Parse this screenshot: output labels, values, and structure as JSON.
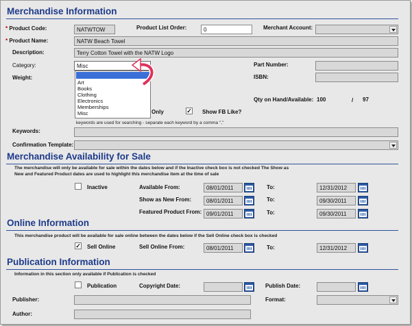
{
  "sections": {
    "merch": "Merchandise Information",
    "avail": "Merchandise Availability for Sale",
    "online": "Online Information",
    "pub": "Publication Information"
  },
  "merch": {
    "product_code_label": "Product Code:",
    "product_code_value": "NATWTOW",
    "product_list_order_label": "Product List Order:",
    "product_list_order_value": "0",
    "merchant_account_label": "Merchant Account:",
    "product_name_label": "Product Name:",
    "product_name_value": "NATW Beach Towel",
    "description_label": "Description:",
    "description_value": "Terry Cotton Towel with the NATW Logo",
    "category_label": "Category:",
    "category_value": "Misc",
    "category_options": [
      "",
      "Art",
      "Books",
      "Clothing",
      "Electronics",
      "Memberships",
      "Misc"
    ],
    "weight_label": "Weight:",
    "part_number_label": "Part Number:",
    "isbn_label": "ISBN:",
    "qty_label": "Qty on Hand/Available:",
    "qty_on_hand": "100",
    "qty_sep": "/",
    "qty_available": "97",
    "only_label": "Only",
    "show_fb_label": "Show FB Like?",
    "show_fb_checked": "✓",
    "keywords_note": "keywords are used for searching - separate each keyword by a comma \",\"",
    "keywords_label": "Keywords:",
    "confirmation_label": "Confirmation Template:"
  },
  "avail": {
    "note_line1": "The merchandise will only be available for sale within the dates below and if the Inactive check box is not checked The Show as",
    "note_line2": "New and Featured Product dates are used to highlight this merchandise item at the time of sale",
    "inactive_label": "Inactive",
    "available_from_label": "Available From:",
    "available_from": "08/01/2011",
    "available_to": "12/31/2012",
    "show_new_label": "Show as New From:",
    "show_new_from": "08/01/2011",
    "show_new_to": "09/30/2011",
    "featured_label": "Featured Product From:",
    "featured_from": "09/01/2011",
    "featured_to": "09/30/2011",
    "to_label": "To:"
  },
  "online": {
    "note": "This merchandise product will be available for sale online between the dates below if the Sell Online check box is checked",
    "sell_online_label": "Sell Online",
    "sell_online_checked": "✓",
    "sell_from_label": "Sell Online From:",
    "sell_from": "08/01/2011",
    "to_label": "To:",
    "sell_to": "12/31/2012"
  },
  "pub": {
    "note": "Information in this section only available if Publication is checked",
    "publication_label": "Publication",
    "copyright_label": "Copyright Date:",
    "publish_date_label": "Publish Date:",
    "publisher_label": "Publisher:",
    "format_label": "Format:",
    "author_label": "Author:"
  },
  "colors": {
    "heading": "#1d3a8a",
    "required": "#c00000",
    "calendar": "#2a5aa6",
    "arrow": "#e0315a",
    "dropdown_highlight": "#3a6fd8"
  }
}
